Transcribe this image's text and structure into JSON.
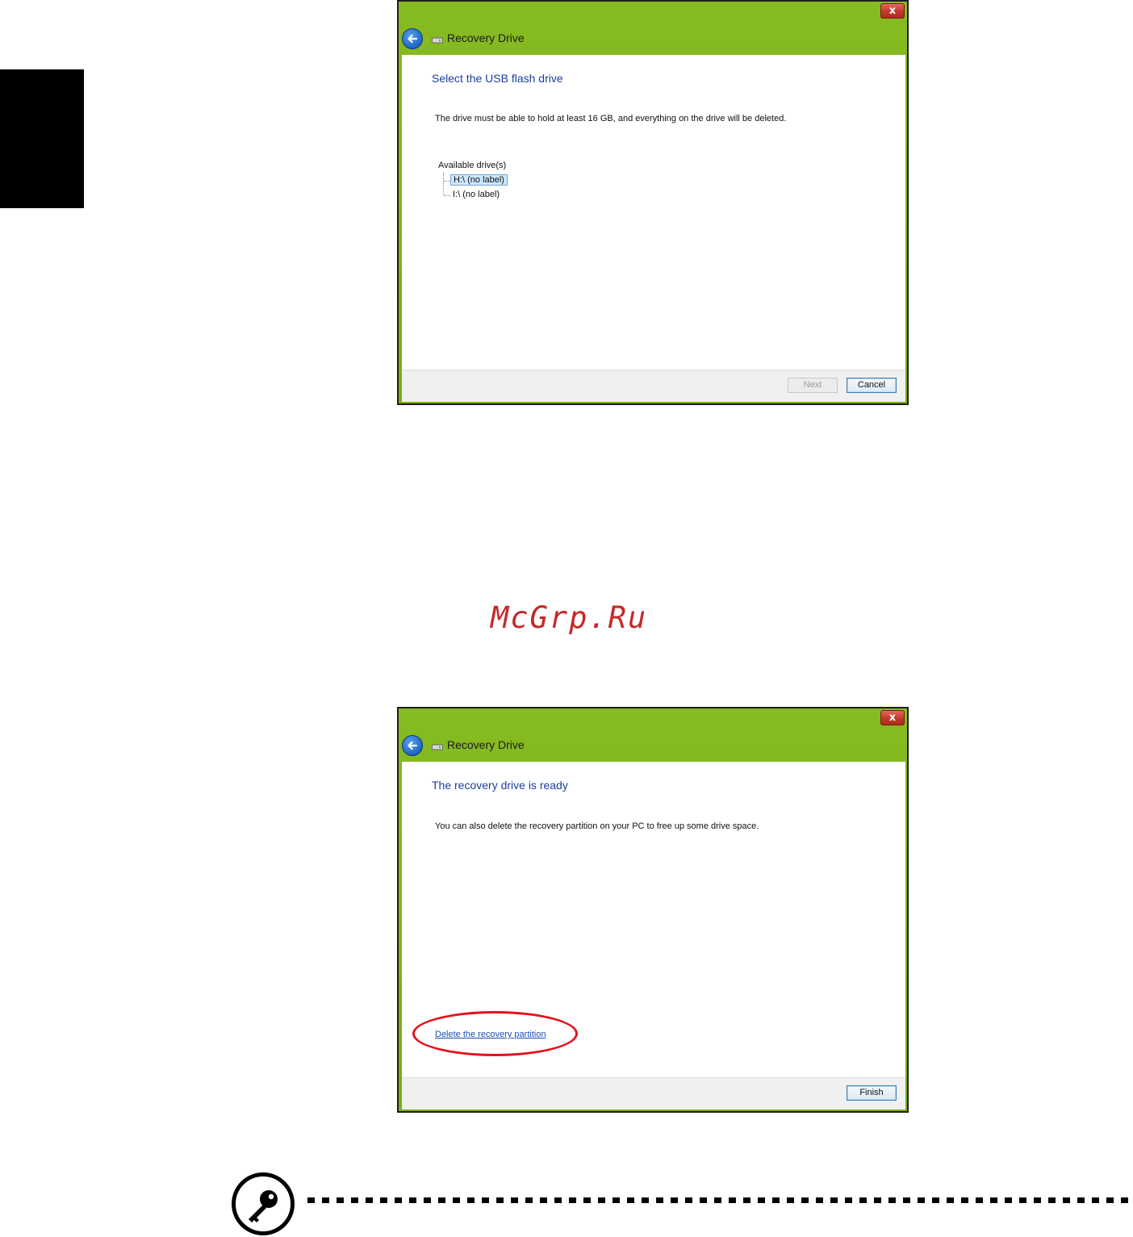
{
  "watermark": "McGrp.Ru",
  "dialog1": {
    "title": "Recovery Drive",
    "close_label": "x",
    "heading": "Select the USB flash drive",
    "description": "The drive must be able to hold at least 16 GB, and everything on the drive will be deleted.",
    "drives_label": "Available drive(s)",
    "drives": [
      {
        "label": "H:\\ (no label)",
        "selected": true
      },
      {
        "label": "I:\\ (no label)",
        "selected": false
      }
    ],
    "next_label": "Next",
    "cancel_label": "Cancel"
  },
  "dialog2": {
    "title": "Recovery Drive",
    "close_label": "x",
    "heading": "The recovery drive is ready",
    "description": "You can also delete the recovery partition on your PC to free up some drive space.",
    "delete_link": "Delete the recovery partition",
    "finish_label": "Finish"
  },
  "colors": {
    "title_bar": "#7eb31c",
    "heading": "#1a3f9b",
    "highlight_ellipse": "#e3121e",
    "watermark": "#c62828"
  },
  "icons": [
    "back-arrow-icon",
    "drive-icon",
    "close-icon",
    "key-icon"
  ]
}
